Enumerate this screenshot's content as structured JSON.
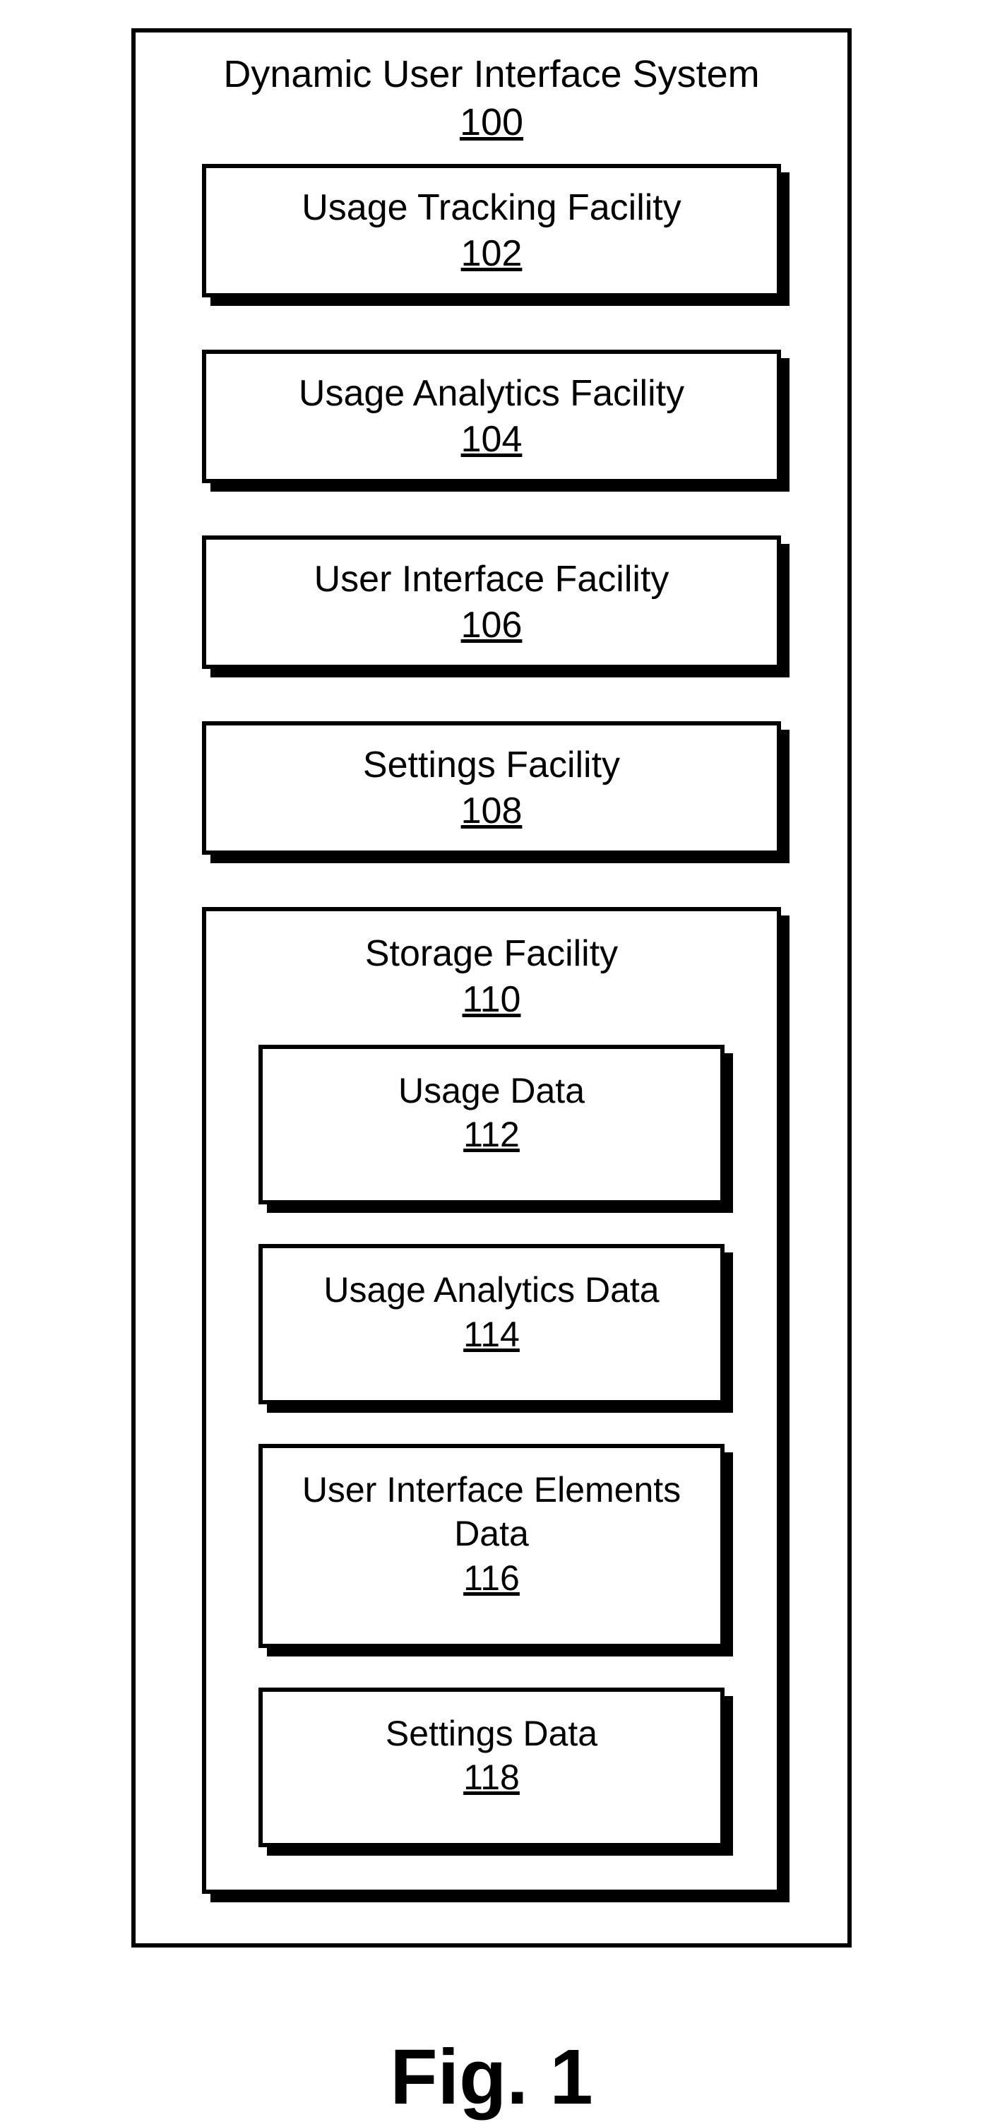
{
  "figure_caption": "Fig. 1",
  "system": {
    "title": "Dynamic User Interface System",
    "ref": "100",
    "facilities": [
      {
        "title": "Usage Tracking Facility",
        "ref": "102"
      },
      {
        "title": "Usage Analytics Facility",
        "ref": "104"
      },
      {
        "title": "User Interface Facility",
        "ref": "106"
      },
      {
        "title": "Settings Facility",
        "ref": "108"
      }
    ],
    "storage": {
      "title": "Storage Facility",
      "ref": "110",
      "data": [
        {
          "title": "Usage Data",
          "ref": "112"
        },
        {
          "title": "Usage Analytics Data",
          "ref": "114"
        },
        {
          "title": "User Interface Elements Data",
          "ref": "116"
        },
        {
          "title": "Settings Data",
          "ref": "118"
        }
      ]
    }
  }
}
